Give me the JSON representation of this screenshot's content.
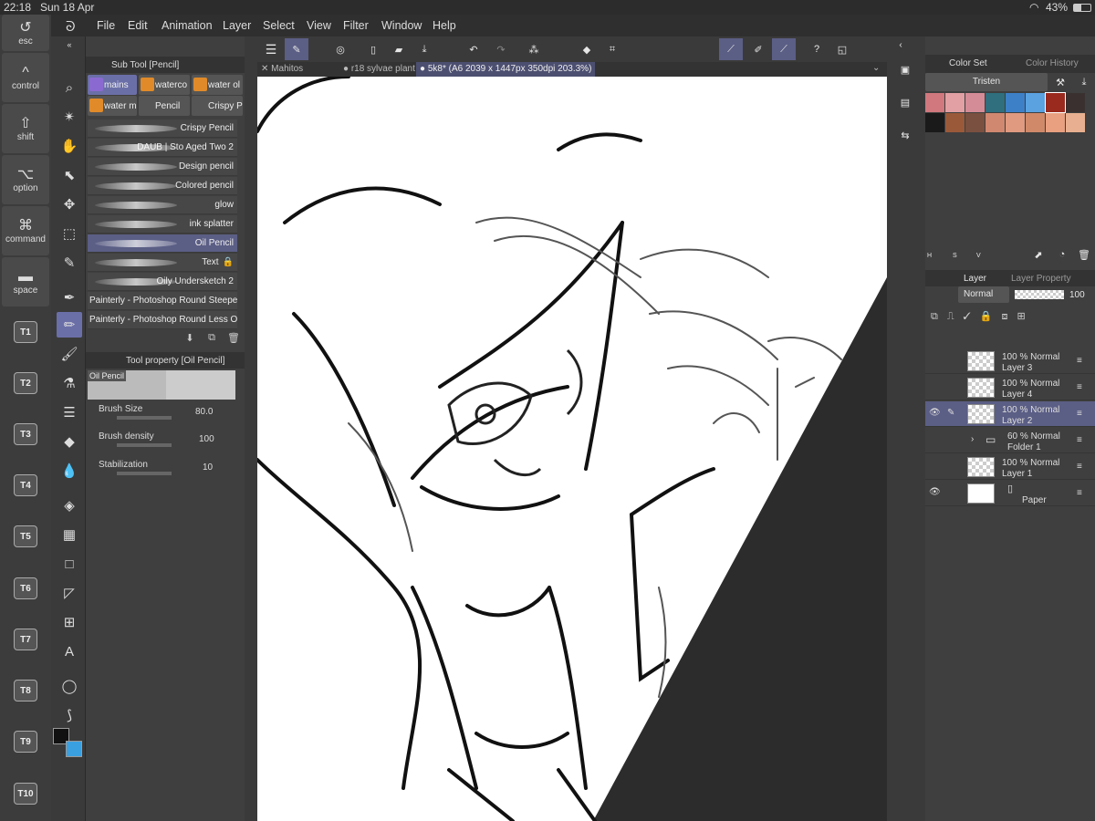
{
  "status": {
    "time": "22:18",
    "date": "Sun 18 Apr",
    "battery": "43%"
  },
  "keys": {
    "esc": "esc",
    "control": "control",
    "shift": "shift",
    "option": "option",
    "command": "command",
    "space": "space",
    "t": [
      "T1",
      "T2",
      "T3",
      "T4",
      "T5",
      "T6",
      "T7",
      "T8",
      "T9",
      "T10"
    ]
  },
  "menu": [
    "File",
    "Edit",
    "Animation",
    "Layer",
    "Select",
    "View",
    "Filter",
    "Window",
    "Help"
  ],
  "subtool": {
    "header": "Sub Tool [Pencil]",
    "tabs": [
      "mains",
      "waterco",
      "water ol",
      "water m",
      "Pencil",
      "Crispy P"
    ],
    "brushes": [
      "Crispy Pencil",
      "DAUB | Sto Aged Two 2",
      "Design pencil",
      "Colored pencil",
      "glow",
      "ink splatter",
      "Oil Pencil",
      "Text",
      "Oily Undersketch 2",
      "Painterly - Photoshop Round Steeper F",
      "Painterly - Photoshop Round Less Opa"
    ]
  },
  "toolprop": {
    "header": "Tool property [Oil Pencil]",
    "preview_label": "Oil Pencil",
    "brush_size_label": "Brush Size",
    "brush_size": "80.0",
    "brush_density_label": "Brush density",
    "brush_density": "100",
    "stabilization_label": "Stabilization",
    "stabilization": "10"
  },
  "doctabs": [
    "Mahitos",
    "r18 sylvae plant",
    "5k8* (A6 2039 x 1447px 350dpi 203.3%)"
  ],
  "color": {
    "tab1": "Color Set",
    "tab2": "Color History",
    "set_name": "Tristen",
    "swatches": [
      "#d0787e",
      "#e2a0a4",
      "#d48c96",
      "#2f6f7e",
      "#3d80c8",
      "#5aa2e0",
      "#9a2a1e",
      "#3a3030",
      "#1a1a1a",
      "#9a5a3a",
      "#7a5040",
      "#d08870",
      "#e09a80",
      "#d08a6a",
      "#e8a080",
      "#e8b090"
    ],
    "letters": [
      "H",
      "S",
      "V"
    ]
  },
  "layers": {
    "tab1": "Layer",
    "tab2": "Layer Property",
    "blend": "Normal",
    "opacity": "100",
    "items": [
      {
        "pct": "100 % Normal",
        "name": "Layer 3"
      },
      {
        "pct": "100 % Normal",
        "name": "Layer 4"
      },
      {
        "pct": "100 % Normal",
        "name": "Layer 2"
      },
      {
        "pct": "60 % Normal",
        "name": "Folder 1"
      },
      {
        "pct": "100 % Normal",
        "name": "Layer 1"
      },
      {
        "pct": "",
        "name": "Paper"
      }
    ]
  }
}
